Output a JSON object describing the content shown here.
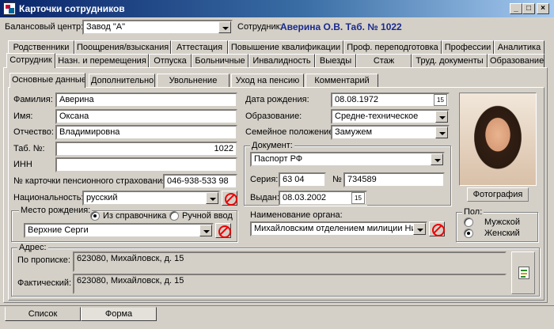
{
  "window": {
    "title": "Карточки сотрудников",
    "controls": [
      "_",
      "□",
      "×"
    ]
  },
  "toolbar": {
    "balance_center_label": "Балансовый центр:",
    "balance_center_value": "Завод \"А\"",
    "employee_label": "Сотрудник:",
    "employee_value": "Аверина О.В. Таб. № 1022"
  },
  "tabs_row1": [
    "Родственники",
    "Поощрения/взыскания",
    "Аттестация",
    "Повышение квалификации",
    "Проф. переподготовка",
    "Профессии",
    "Аналитика"
  ],
  "tabs_row2": [
    "Сотрудник",
    "Назн. и перемещения",
    "Отпуска",
    "Больничные",
    "Инвалидность",
    "Выезды",
    "Стаж",
    "Труд. документы",
    "Образование"
  ],
  "subtabs": [
    "Основные данные",
    "Дополнительно",
    "Увольнение",
    "Уход на пенсию",
    "Комментарий"
  ],
  "form": {
    "surname_label": "Фамилия:",
    "surname": "Аверина",
    "name_label": "Имя:",
    "name": "Оксана",
    "patronymic_label": "Отчество:",
    "patronymic": "Владимировна",
    "tab_no_label": "Таб. №:",
    "tab_no": "1022",
    "inn_label": "ИНН",
    "inn": "",
    "pension_label": "№ карточки пенсионного страхования:",
    "pension": "046-938-533 98",
    "nationality_label": "Национальность:",
    "nationality": "русский",
    "birthplace_group": "Место рождения:",
    "birthplace_opt1": "Из справочника",
    "birthplace_opt2": "Ручной ввод",
    "birthplace": "Верхние Серги",
    "dob_label": "Дата рождения:",
    "dob": "08.08.1972",
    "education_label": "Образование:",
    "education": "Средне-техническое",
    "marital_label": "Семейное положение:",
    "marital": "Замужем",
    "document_group": "Документ:",
    "document_type": "Паспорт РФ",
    "series_label": "Серия:",
    "series": "63 04",
    "number_label": "№",
    "number": "734589",
    "issued_label": "Выдан:",
    "issued": "08.03.2002",
    "authority_label": "Наименование органа:",
    "authority": "Михайловским отделением милиции  Ни",
    "calendar_icon_text": "15"
  },
  "photo": {
    "button_label": "Фотография"
  },
  "gender": {
    "label": "Пол:",
    "male": "Мужской",
    "female": "Женский",
    "selected": "female"
  },
  "address": {
    "group_label": "Адрес:",
    "registration_label": "По прописке:",
    "registration": "623080, Михайловск, д. 15",
    "actual_label": "Фактический:",
    "actual": "623080, Михайловск, д. 15"
  },
  "bottom_tabs": [
    "Список",
    "Форма"
  ]
}
